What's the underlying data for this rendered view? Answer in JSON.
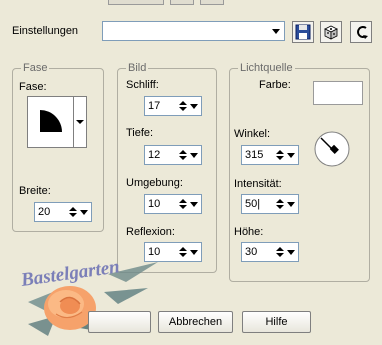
{
  "preset": {
    "label": "Einstellungen",
    "value": ""
  },
  "toolbar": {
    "save_icon": "save-icon",
    "dice_icon": "dice-icon",
    "reset_icon": "undo-icon"
  },
  "fase_group": {
    "title": "Fase",
    "fase_label": "Fase:",
    "breite_label": "Breite:",
    "breite_value": "20"
  },
  "bild_group": {
    "title": "Bild",
    "schliff_label": "Schliff:",
    "schliff_value": "17",
    "tiefe_label": "Tiefe:",
    "tiefe_value": "12",
    "umgebung_label": "Umgebung:",
    "umgebung_value": "10",
    "reflexion_label": "Reflexion:",
    "reflexion_value": "10"
  },
  "licht_group": {
    "title": "Lichtquelle",
    "farbe_label": "Farbe:",
    "farbe_value": "#ffffff",
    "winkel_label": "Winkel:",
    "winkel_value": "315",
    "intensitaet_label": "Intensität:",
    "intensitaet_value": "50",
    "hoehe_label": "Höhe:",
    "hoehe_value": "30"
  },
  "buttons": {
    "ok_label": "",
    "cancel_label": "Abbrechen",
    "help_label": "Hilfe"
  },
  "watermark": {
    "text": "Bastelgarten"
  }
}
